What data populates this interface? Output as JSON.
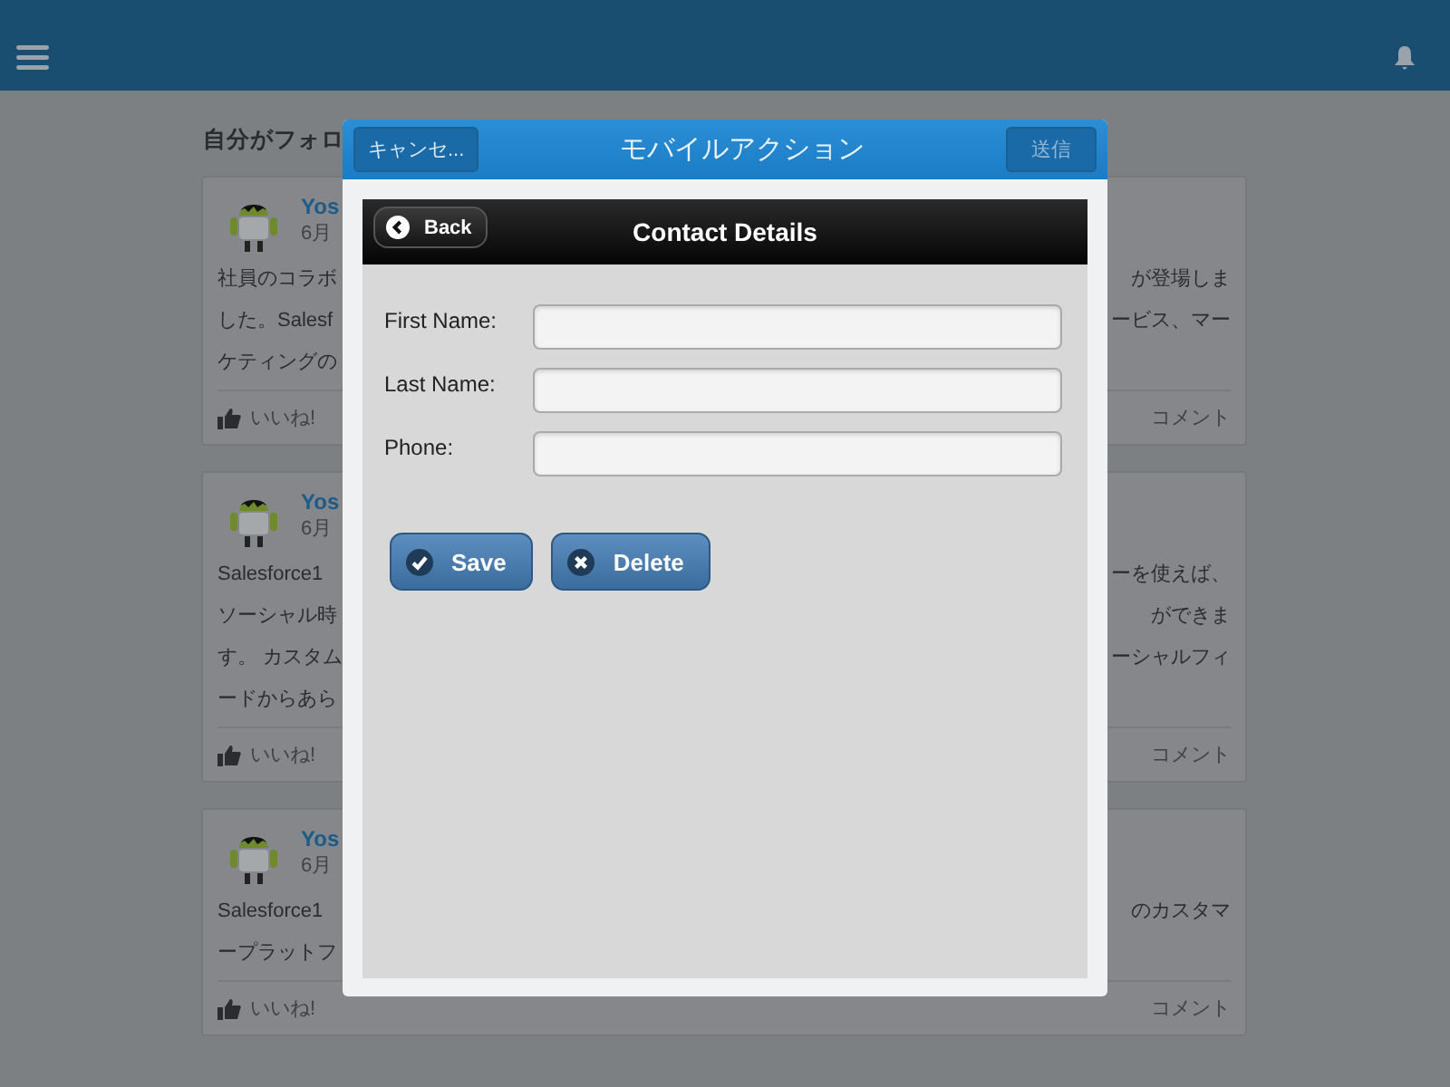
{
  "feed": {
    "heading": "自分がフォロ",
    "posts": [
      {
        "author": "Yos",
        "date": "6月",
        "lines": [
          {
            "left": "社員のコラボ",
            "right": "が登場しま"
          },
          {
            "left": "した。Salesf",
            "right": "ービス、マー"
          },
          {
            "left": "ケティングの"
          }
        ],
        "like": "いいね!",
        "comment": "コメント"
      },
      {
        "author": "Yos",
        "date": "6月",
        "lines": [
          {
            "left": "Salesforce1",
            "right": "ーを使えば、"
          },
          {
            "left": "ソーシャル時",
            "right": "ができま"
          },
          {
            "left": "す。 カスタム",
            "right": "ーシャルフィ"
          },
          {
            "left": "ードからあら"
          }
        ],
        "like": "いいね!",
        "comment": "コメント"
      },
      {
        "author": "Yos",
        "date": "6月",
        "lines": [
          {
            "left": "Salesforce1",
            "right": "のカスタマ"
          },
          {
            "left": "ープラットフ"
          }
        ],
        "like": "いいね!",
        "comment": "コメント"
      }
    ]
  },
  "modal": {
    "cancel": "キャンセ...",
    "title": "モバイルアクション",
    "send": "送信",
    "nav": {
      "back": "Back",
      "title": "Contact Details"
    },
    "fields": [
      {
        "label": "First Name:"
      },
      {
        "label": "Last Name:"
      },
      {
        "label": "Phone:"
      }
    ],
    "buttons": [
      {
        "kind": "save",
        "label": "Save"
      },
      {
        "kind": "delete",
        "label": "Delete"
      }
    ]
  }
}
